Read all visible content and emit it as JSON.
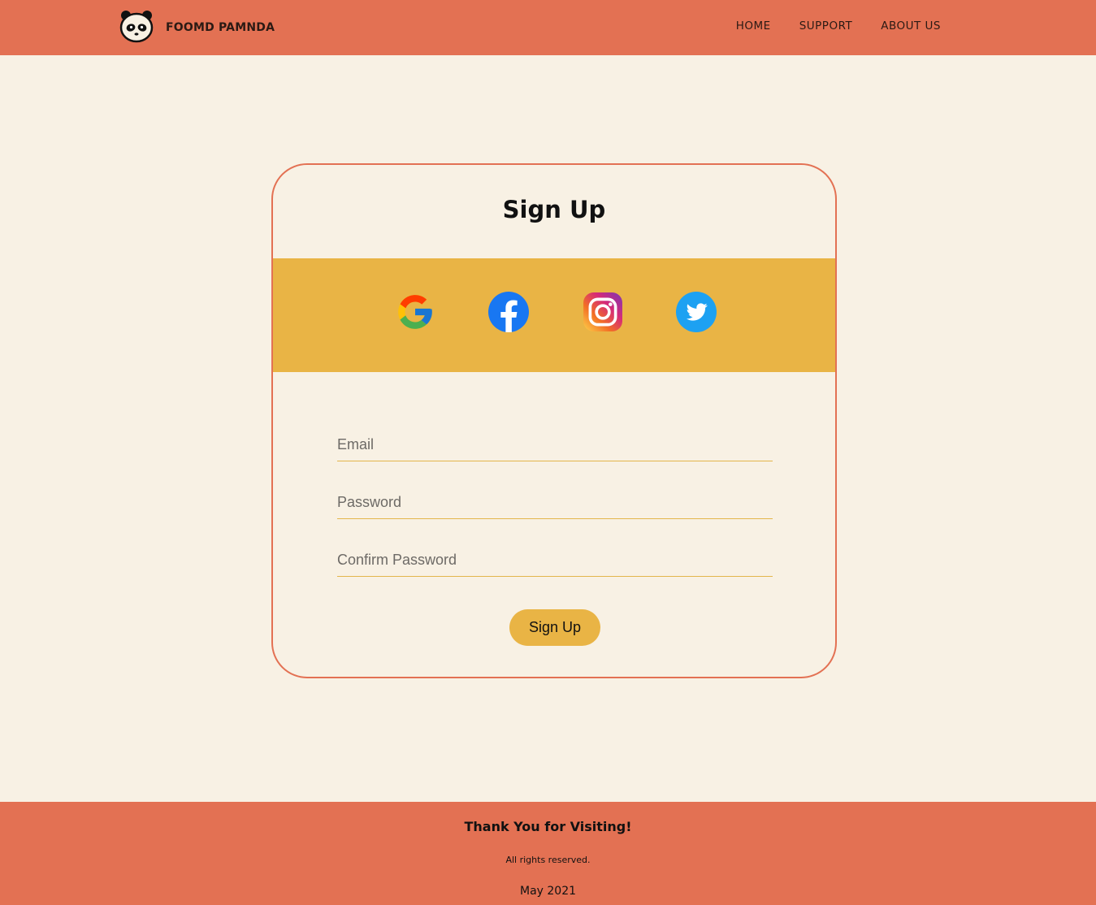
{
  "brand": {
    "name": "FOOMD PAMNDA",
    "logo_icon": "panda-face-icon"
  },
  "nav": {
    "items": [
      {
        "label": "HOME"
      },
      {
        "label": "SUPPORT"
      },
      {
        "label": "ABOUT US"
      }
    ]
  },
  "signup": {
    "title": "Sign Up",
    "social": [
      {
        "icon": "google-icon"
      },
      {
        "icon": "facebook-icon"
      },
      {
        "icon": "instagram-icon"
      },
      {
        "icon": "twitter-icon"
      }
    ],
    "fields": {
      "email": {
        "placeholder": "Email",
        "value": ""
      },
      "password": {
        "placeholder": "Password",
        "value": ""
      },
      "confirm_password": {
        "placeholder": "Confirm Password",
        "value": ""
      }
    },
    "submit_label": "Sign Up"
  },
  "footer": {
    "thanks": "Thank You for Visiting!",
    "rights": "All rights reserved.",
    "date": "May 2021"
  },
  "colors": {
    "primary": "#e37153",
    "accent": "#e9b445",
    "background": "#f8f1e4"
  }
}
